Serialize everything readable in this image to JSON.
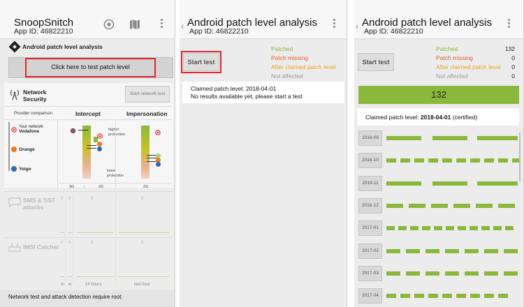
{
  "screen1": {
    "app_title": "SnoopSnitch",
    "app_id": "App ID: 46822210",
    "patch_section_title": "Android patch level analysis",
    "patch_button": "Click here to test patch level",
    "network_security_label": "Network Security",
    "start_network_test": "Start network test",
    "provider_comparison": "Provider comparison",
    "col_intercept": "Intercept",
    "col_impersonation": "Impersonation",
    "providers": [
      {
        "line1": "Your network",
        "line2": "Vodafone"
      },
      {
        "line1": "",
        "line2": "Orange"
      },
      {
        "line1": "",
        "line2": "Yoigo"
      }
    ],
    "higher_protection": "higher protection",
    "lower_protection": "lower protection",
    "tick_3g": "3G",
    "tick_2g_a": "2G",
    "tick_2g_b": "2G",
    "sms_label": "SMS & SS7 attacks",
    "imsi_label": "IMSI Catcher",
    "zero": "0",
    "axis_m": "m",
    "axis_w": "w",
    "axis_24h": "24 hours",
    "axis_last_hour": "last hour",
    "footer": "Network test and attack detection require root.",
    "colors": {
      "provider_vodafone": "#e0242a",
      "provider_orange": "#f07a1a",
      "provider_yoigo": "#2b6bb5",
      "bar_green": "#8ab73c"
    }
  },
  "screen2": {
    "title": "Android patch level analysis",
    "app_id": "App ID: 46822210",
    "start_test": "Start test",
    "legend": {
      "patched": "Patched",
      "patch_missing": "Patch missing",
      "after_claimed": "After claimed patch level",
      "not_affected": "Not affected"
    },
    "claimed": "Claimed patch level: 2018-04-01",
    "no_results": "No results available yet, please start a test"
  },
  "screen3": {
    "title": "Android patch level analysis",
    "app_id": "App ID: 46822210",
    "start_test": "Start test",
    "legend": {
      "patched": "Patched",
      "patch_missing": "Patch missing",
      "after_claimed": "After claimed patch level",
      "not_affected": "Not affected"
    },
    "counts": {
      "patched": "132",
      "patch_missing": "0",
      "after_claimed": "0",
      "not_affected": "0"
    },
    "total": "132",
    "claimed_prefix": "Claimed patch level: ",
    "claimed_value": "2018-04-01",
    "claimed_suffix": " (certified)",
    "months": [
      "2016-09",
      "2016-10",
      "2016-11",
      "2016-12",
      "2017-01",
      "2017-02",
      "2017-03",
      "2017-04"
    ],
    "colors": {
      "patched": "#8ab73c",
      "patch_missing": "#e55d2b",
      "after_claimed": "#f0a020",
      "not_affected": "#9a9a9a"
    }
  }
}
